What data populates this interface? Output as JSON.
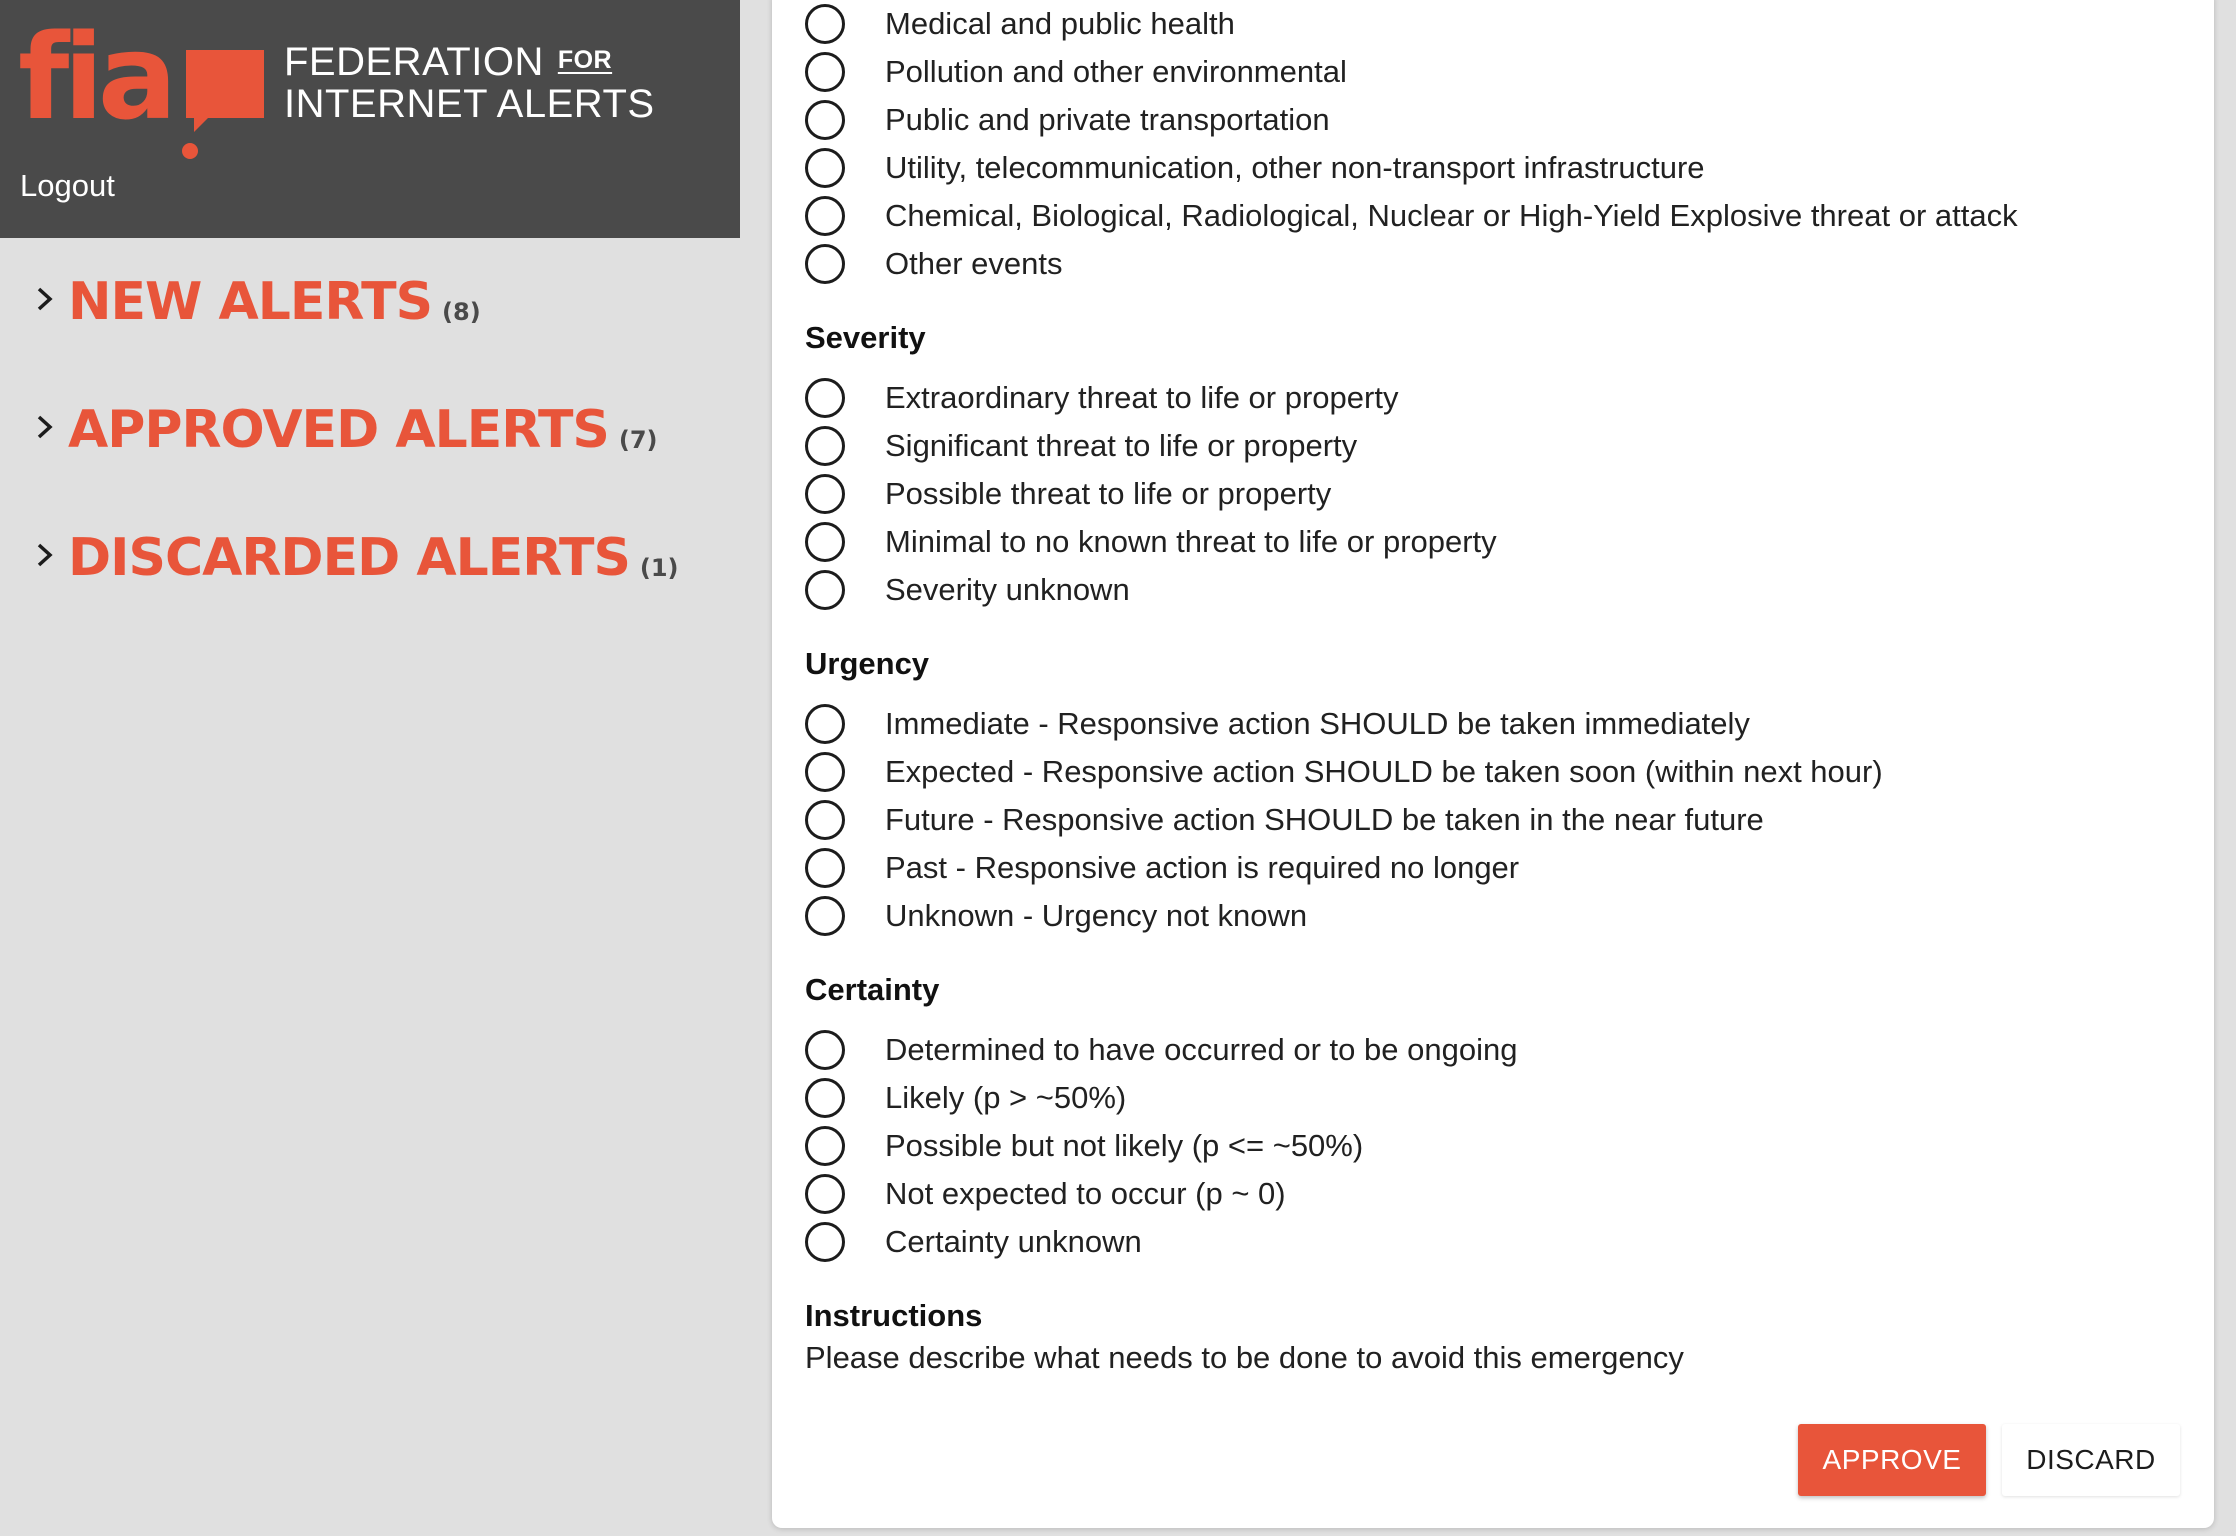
{
  "brand": {
    "logo_text": "fia",
    "line1": "FEDERATION",
    "line1_small": "FOR",
    "line2": "INTERNET ALERTS",
    "logout_label": "Logout",
    "accent_color": "#e8553a",
    "header_bg": "#4a4a4a"
  },
  "sidebar": {
    "groups": [
      {
        "label": "NEW ALERTS",
        "count": "(8)",
        "icon": "chevron-right-icon"
      },
      {
        "label": "APPROVED ALERTS",
        "count": "(7)",
        "icon": "chevron-right-icon"
      },
      {
        "label": "DISCARDED ALERTS",
        "count": "(1)",
        "icon": "chevron-right-icon"
      }
    ]
  },
  "form": {
    "category": {
      "options": [
        "Medical and public health",
        "Pollution and other environmental",
        "Public and private transportation",
        "Utility, telecommunication, other non-transport infrastructure",
        "Chemical, Biological, Radiological, Nuclear or High-Yield Explosive threat or attack",
        "Other events"
      ]
    },
    "severity": {
      "title": "Severity",
      "options": [
        "Extraordinary threat to life or property",
        "Significant threat to life or property",
        "Possible threat to life or property",
        "Minimal to no known threat to life or property",
        "Severity unknown"
      ]
    },
    "urgency": {
      "title": "Urgency",
      "options": [
        "Immediate - Responsive action SHOULD be taken immediately",
        "Expected - Responsive action SHOULD be taken soon (within next hour)",
        "Future - Responsive action SHOULD be taken in the near future",
        "Past - Responsive action is required no longer",
        "Unknown - Urgency not known"
      ]
    },
    "certainty": {
      "title": "Certainty",
      "options": [
        "Determined to have occurred or to be ongoing",
        "Likely (p > ~50%)",
        "Possible but not likely (p <= ~50%)",
        "Not expected to occur (p ~ 0)",
        "Certainty unknown"
      ]
    },
    "instructions": {
      "title": "Instructions",
      "text": "Please describe what needs to be done to avoid this emergency"
    },
    "approve_label": "APPROVE",
    "discard_label": "DISCARD"
  }
}
